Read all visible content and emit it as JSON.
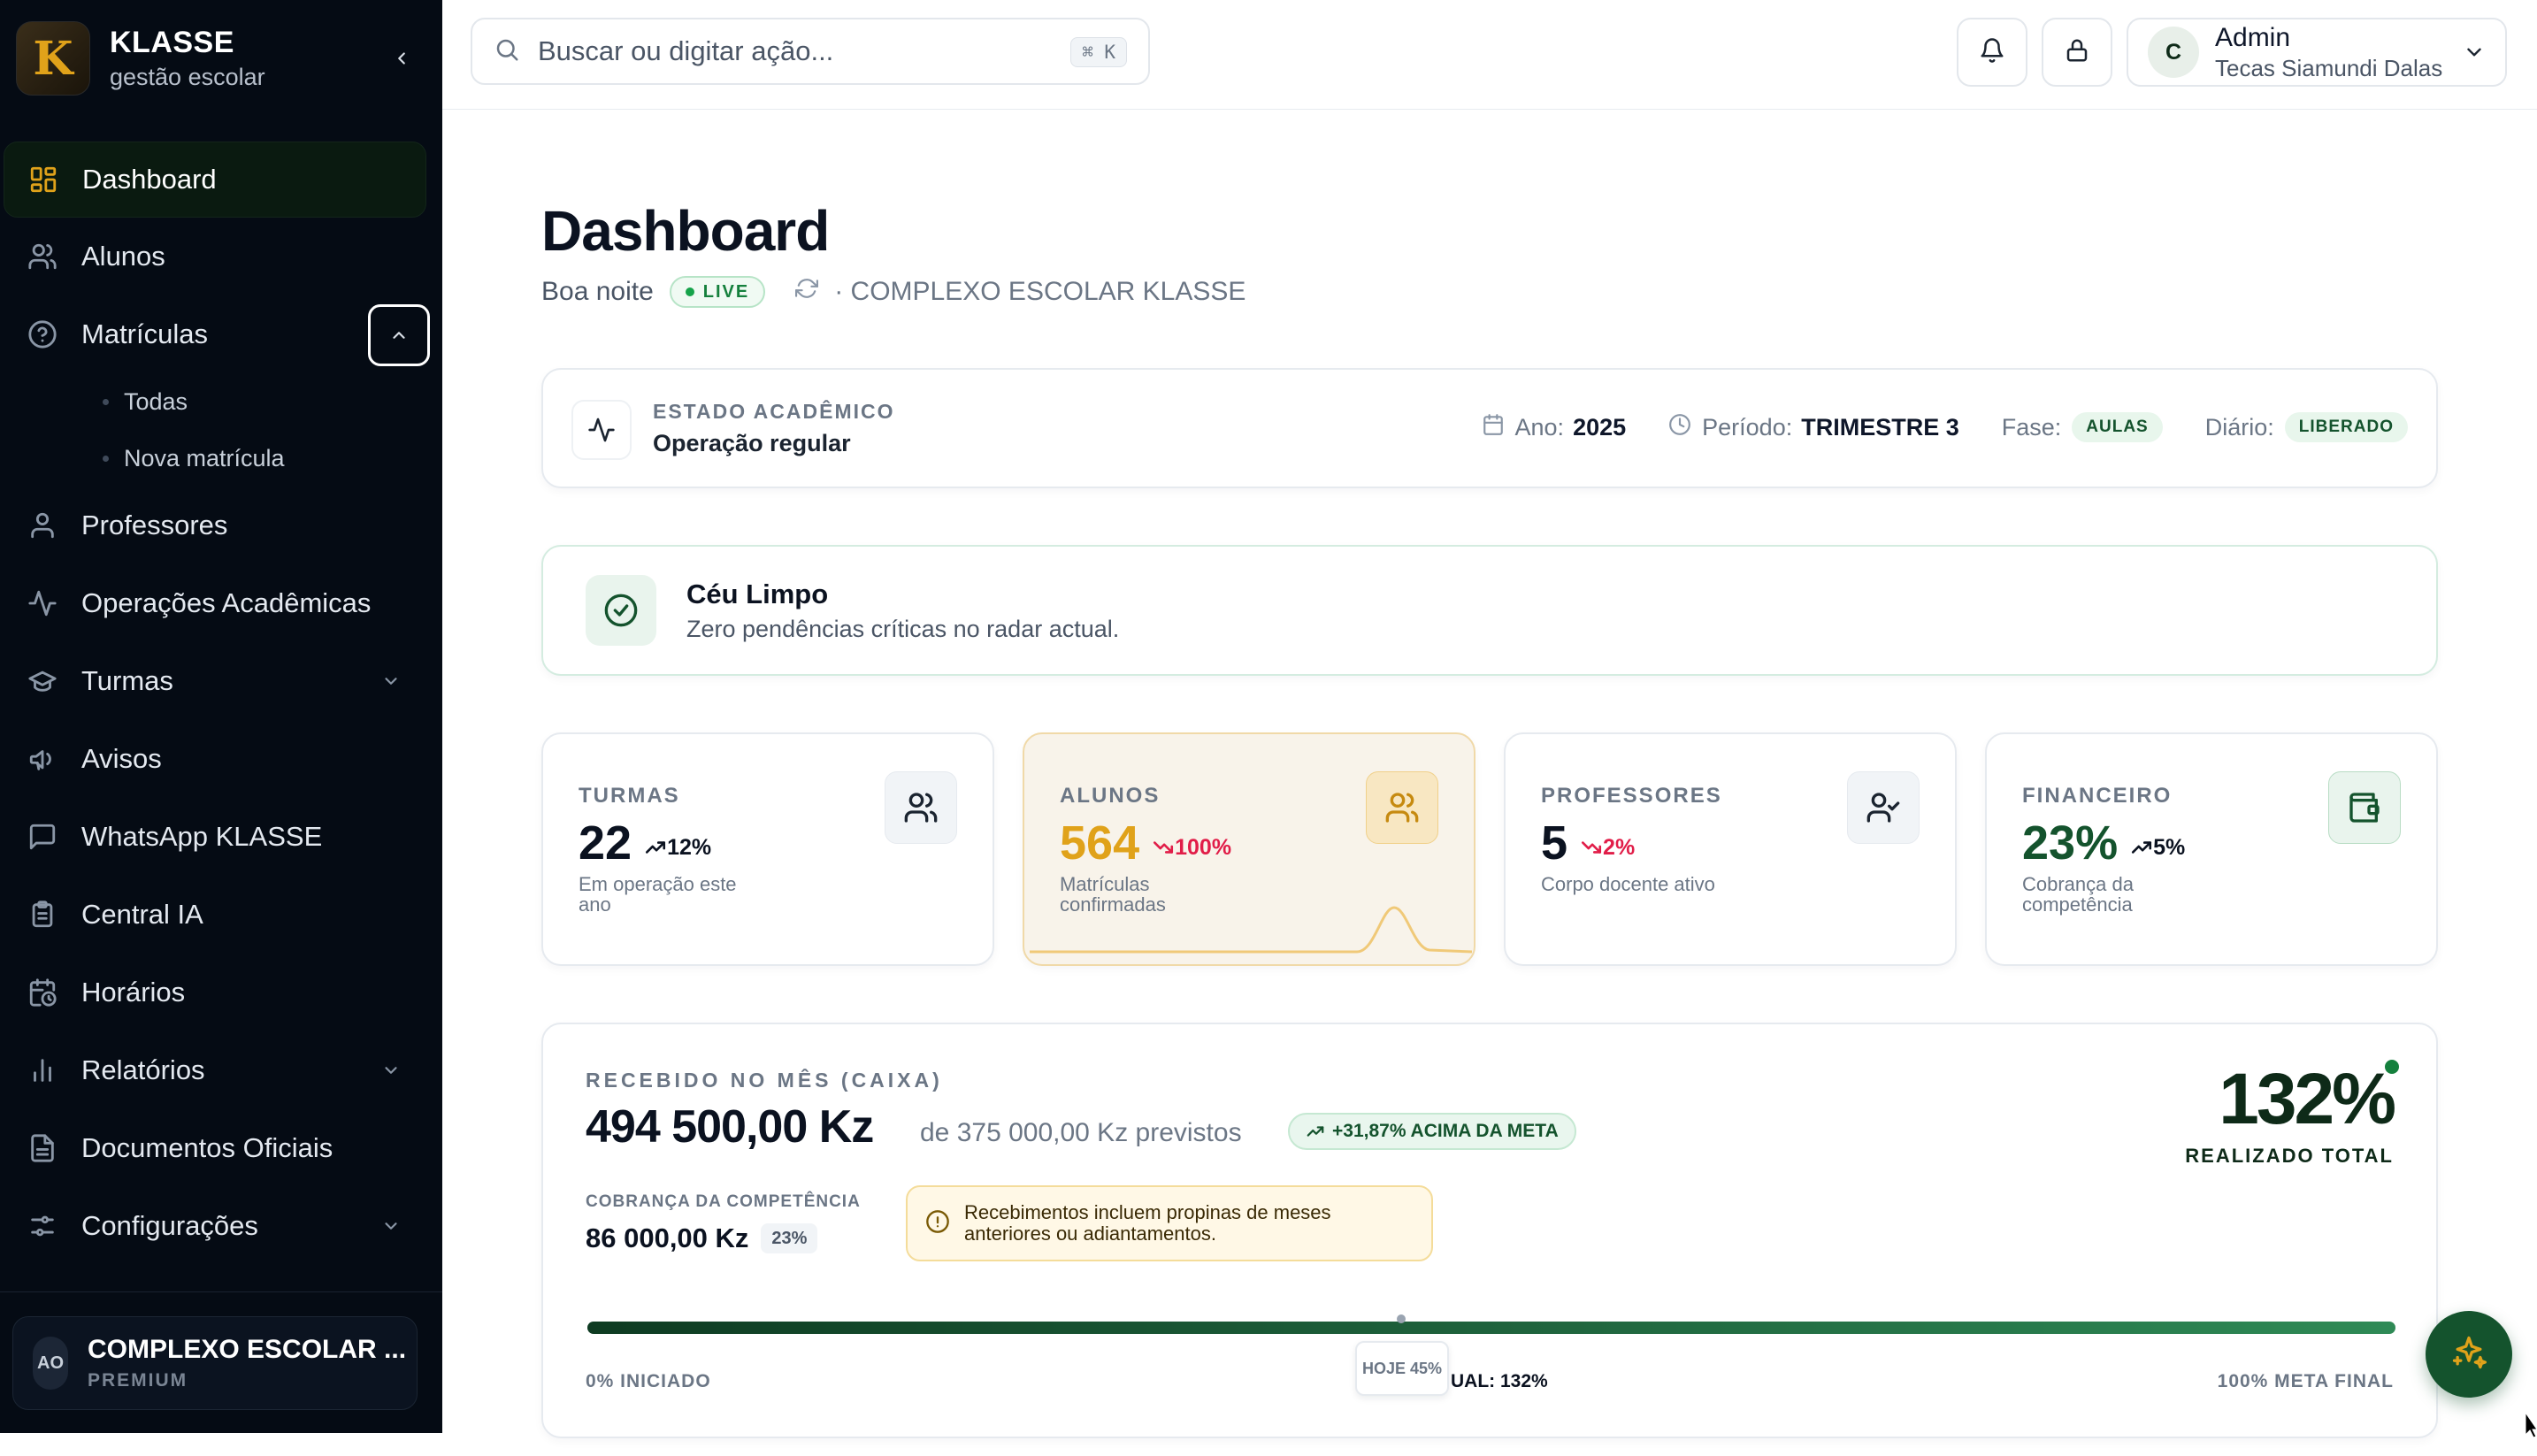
{
  "brand": {
    "name": "KLASSE",
    "subtitle": "gestão escolar",
    "logo_letter": "K"
  },
  "sidebar": {
    "items": [
      {
        "label": "Dashboard",
        "icon": "grid-icon",
        "active": true
      },
      {
        "label": "Alunos",
        "icon": "users-icon"
      },
      {
        "label": "Matrículas",
        "icon": "help-circle-icon",
        "expanded": true,
        "children": [
          {
            "label": "Todas"
          },
          {
            "label": "Nova matrícula"
          }
        ]
      },
      {
        "label": "Professores",
        "icon": "user-icon"
      },
      {
        "label": "Operações Acadêmicas",
        "icon": "activity-icon"
      },
      {
        "label": "Turmas",
        "icon": "graduation-cap-icon",
        "has_children": true
      },
      {
        "label": "Avisos",
        "icon": "megaphone-icon"
      },
      {
        "label": "WhatsApp KLASSE",
        "icon": "message-square-icon"
      },
      {
        "label": "Central IA",
        "icon": "clipboard-icon"
      },
      {
        "label": "Horários",
        "icon": "calendar-clock-icon"
      },
      {
        "label": "Relatórios",
        "icon": "bar-chart-icon",
        "has_children": true
      },
      {
        "label": "Documentos Oficiais",
        "icon": "file-text-icon"
      },
      {
        "label": "Configurações",
        "icon": "sliders-icon",
        "has_children": true
      }
    ],
    "org": {
      "initials": "AO",
      "name": "COMPLEXO ESCOLAR ...",
      "plan": "PREMIUM"
    }
  },
  "topbar": {
    "search_placeholder": "Buscar ou digitar ação...",
    "shortcut": "⌘ K",
    "user": {
      "initial": "C",
      "role": "Admin",
      "name": "Tecas Siamundi Dalas"
    }
  },
  "header": {
    "title": "Dashboard",
    "greeting": "Boa noite",
    "live": "LIVE",
    "school": "· COMPLEXO ESCOLAR KLASSE"
  },
  "academic_state": {
    "label": "ESTADO ACADÊMICO",
    "value": "Operação regular",
    "year_label": "Ano:",
    "year": "2025",
    "period_label": "Período:",
    "period": "TRIMESTRE 3",
    "phase_label": "Fase:",
    "phase": "AULAS",
    "diary_label": "Diário:",
    "diary": "LIBERADO"
  },
  "clear_sky": {
    "title": "Céu Limpo",
    "subtitle": "Zero pendências críticas no radar actual."
  },
  "stats": [
    {
      "label": "TURMAS",
      "value": "22",
      "trend": "12%",
      "trend_dir": "up",
      "sub": "Em operação este ano",
      "icon": "users-icon"
    },
    {
      "label": "ALUNOS",
      "value": "564",
      "trend": "100%",
      "trend_dir": "down",
      "sub": "Matrículas confirmadas",
      "icon": "users-icon"
    },
    {
      "label": "PROFESSORES",
      "value": "5",
      "trend": "2%",
      "trend_dir": "down",
      "sub": "Corpo docente ativo",
      "icon": "user-check-icon"
    },
    {
      "label": "FINANCEIRO",
      "value": "23%",
      "trend": "5%",
      "trend_dir": "up",
      "sub": "Cobrança da competência",
      "icon": "wallet-icon"
    }
  ],
  "revenue": {
    "label": "RECEBIDO NO MÊS (CAIXA)",
    "amount": "494 500,00 Kz",
    "expected": "de 375 000,00 Kz previstos",
    "badge": "+31,87% ACIMA DA META",
    "total_pct": "132%",
    "total_label": "REALIZADO TOTAL",
    "competence_label": "COBRANÇA DA COMPETÊNCIA",
    "competence_value": "86 000,00 Kz",
    "competence_pct": "23%",
    "warning": "Recebimentos incluem propinas de meses anteriores ou adiantamentos.",
    "progress": {
      "fill_fraction": 1.0,
      "today_fraction": 0.45,
      "today_label": "HOJE 45%",
      "start_label": "0% INICIADO",
      "current_label": "UAL: 132%",
      "end_label": "100% META FINAL"
    }
  },
  "colors": {
    "accent_green": "#14532d",
    "accent_gold": "#e0a21a",
    "trend_down": "#e11d48",
    "sidebar_bg": "#050b14"
  }
}
